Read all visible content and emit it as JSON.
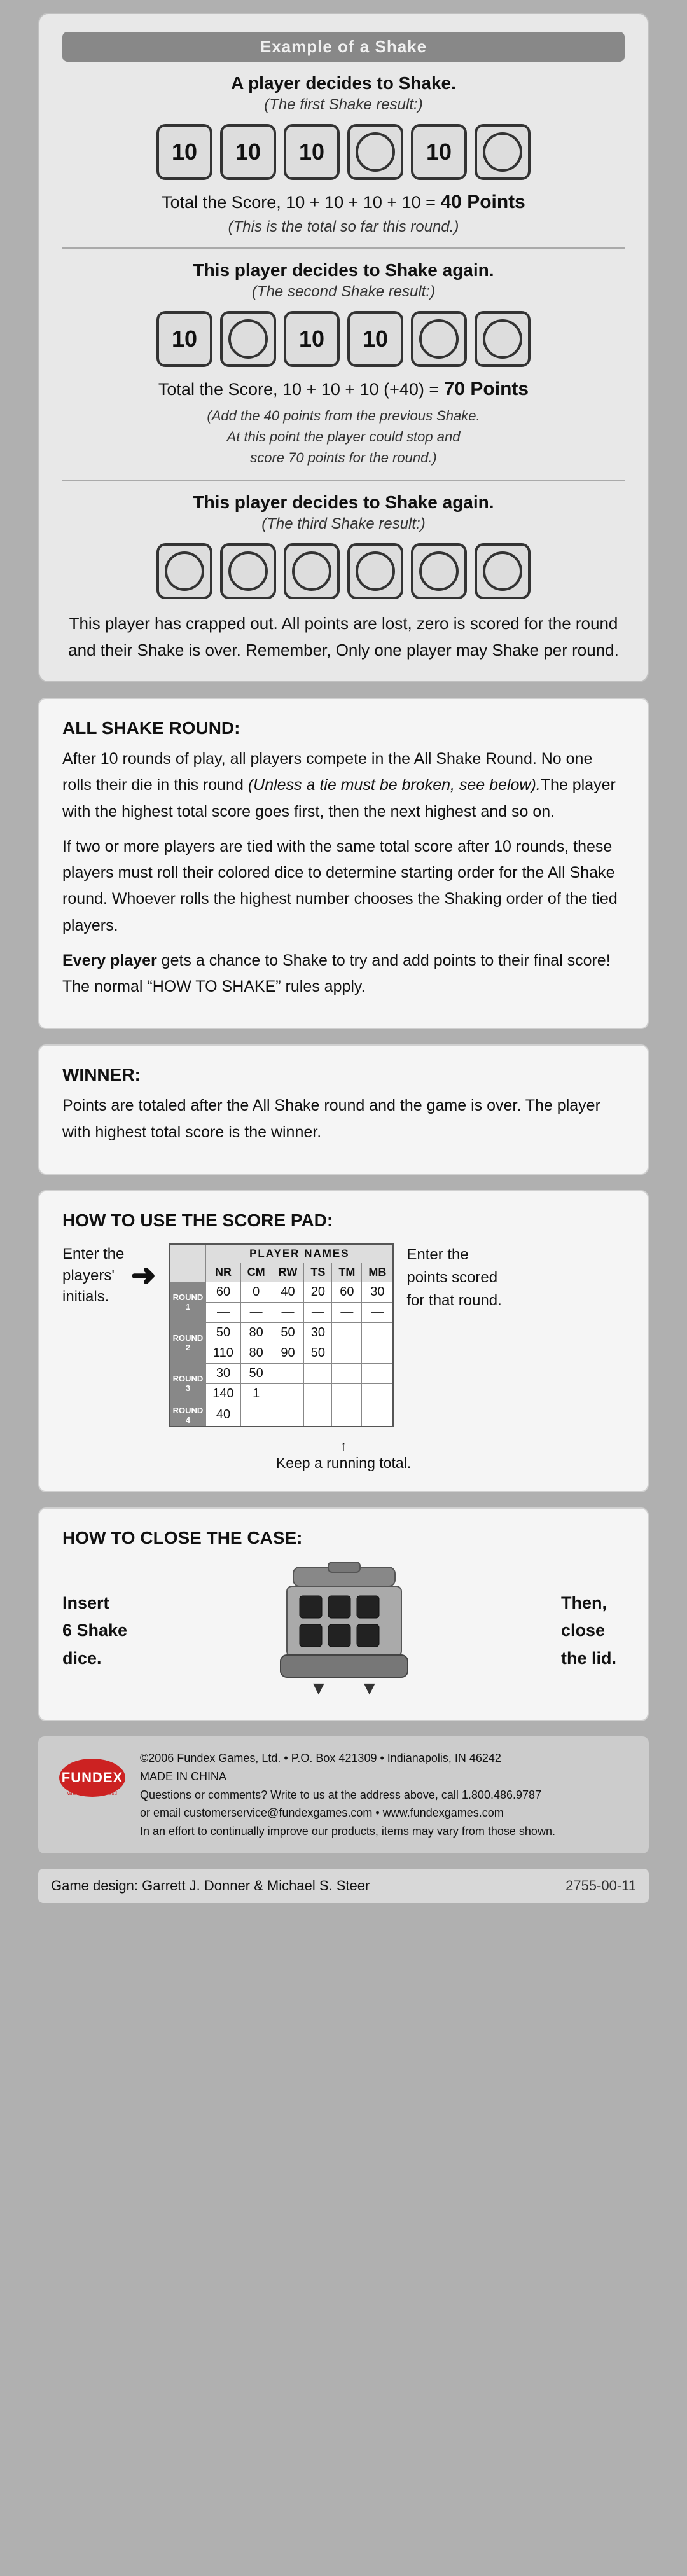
{
  "page": {
    "background": "#b0b0b0"
  },
  "shake_example": {
    "header": "Example of a Shake",
    "shake1_title": "A player decides to Shake.",
    "shake1_subtitle": "(The first Shake result:)",
    "dice_row1": [
      {
        "value": "10",
        "blank": false
      },
      {
        "value": "10",
        "blank": false
      },
      {
        "value": "10",
        "blank": false
      },
      {
        "value": "",
        "blank": true
      },
      {
        "value": "10",
        "blank": false
      },
      {
        "value": "",
        "blank": true
      }
    ],
    "score1_line": "Total the Score, 10 + 10 + 10 + 10 =",
    "score1_bold": "40 Points",
    "score1_note": "(This is the total so far this round.)",
    "shake2_title": "This player decides to Shake again.",
    "shake2_subtitle": "(The second Shake result:)",
    "dice_row2": [
      {
        "value": "10",
        "blank": false
      },
      {
        "value": "",
        "blank": true
      },
      {
        "value": "10",
        "blank": false
      },
      {
        "value": "10",
        "blank": false
      },
      {
        "value": "",
        "blank": true
      },
      {
        "value": "",
        "blank": true
      }
    ],
    "score2_line": "Total the Score, 10 + 10 + 10 (+40) =",
    "score2_bold": "70 Points",
    "score2_note1": "(Add the 40 points from the previous Shake.",
    "score2_note2": "At this point the player could stop and",
    "score2_note3": "score 70 points for the round.)",
    "shake3_title": "This player decides to Shake again.",
    "shake3_subtitle": "(The third Shake result:)",
    "dice_row3": [
      {
        "value": "",
        "blank": true
      },
      {
        "value": "",
        "blank": true
      },
      {
        "value": "",
        "blank": true
      },
      {
        "value": "",
        "blank": true
      },
      {
        "value": "",
        "blank": true
      },
      {
        "value": "",
        "blank": true
      }
    ],
    "crapped_out": "This player has crapped out. All points are lost, zero is scored for the round and their Shake is over. Remember, Only one player may Shake per round."
  },
  "all_shake_round": {
    "title": "ALL SHAKE ROUND:",
    "para1": "After 10 rounds of play, all players compete in the All Shake Round. No one rolls their die in this round (Unless a tie must be broken, see below).The player with the highest total score goes first, then the next highest and so on.",
    "para1_italic": "(Unless a tie must be broken, see below).",
    "para2": "If two or more players are tied with the same total score after 10 rounds, these players must roll their colored dice to determine starting order for the All Shake round. Whoever rolls the highest number chooses the Shaking order of the tied players.",
    "para3_prefix": "Every player",
    "para3_suffix": " gets a chance to Shake to try and add points to their final score! The normal “HOW TO SHAKE” rules apply."
  },
  "winner": {
    "title": "WINNER:",
    "text": "Points are totaled after the All Shake round and the game is over. The player with highest total score is the winner."
  },
  "score_pad": {
    "title": "HOW TO USE THE SCORE PAD:",
    "enter_initials_label": "Enter the\nplayers'\ninitials.",
    "player_names_header": "PLAYER NAMES",
    "columns": [
      "NR",
      "CM",
      "RW",
      "TS",
      "TM",
      "MB"
    ],
    "rows": [
      {
        "round": "ROUND 1",
        "values": [
          "60",
          "0",
          "40",
          "20",
          "60",
          "30"
        ]
      },
      {
        "round": "",
        "values": [
          "—",
          "—",
          "—",
          "—",
          "—",
          "—"
        ]
      },
      {
        "round": "ROUND 2",
        "values": [
          "50",
          "80",
          "50",
          "30",
          "",
          ""
        ]
      },
      {
        "round": "",
        "values": [
          "110",
          "80",
          "90",
          "50",
          "",
          ""
        ]
      },
      {
        "round": "ROUND 3",
        "values": [
          "30",
          "50",
          "",
          "",
          "",
          ""
        ]
      },
      {
        "round": "",
        "values": [
          "140",
          "1",
          "",
          "",
          "",
          ""
        ]
      },
      {
        "round": "ROUND 4",
        "values": [
          "40",
          "",
          "",
          "",
          "",
          ""
        ]
      }
    ],
    "enter_points_label": "Enter the\npoints scored\nfor that round.",
    "running_total_label": "Keep a\nrunning total.",
    "arrow_label": "→"
  },
  "close_case": {
    "title": "HOW TO CLOSE THE CASE:",
    "insert_label": "Insert\n6 Shake\ndice.",
    "then_label": "Then,\nclose\nthe lid."
  },
  "footer": {
    "copyright": "©2006 Fundex Games, Ltd. • P.O. Box 421309 • Indianapolis, IN 46242",
    "made_in": "MADE IN CHINA",
    "questions": "Questions or comments? Write to us at the address above, call 1.800.486.9787",
    "or_email": "or email customerservice@fundexgames.com • www.fundexgames.com",
    "improve": "In an effort to continually improve our products, items may vary from those shown.",
    "game_design": "Game design: Garrett J. Donner & Michael S. Steer",
    "part_number": "2755-00-11",
    "fundex_tagline": "where fun comes first!"
  }
}
